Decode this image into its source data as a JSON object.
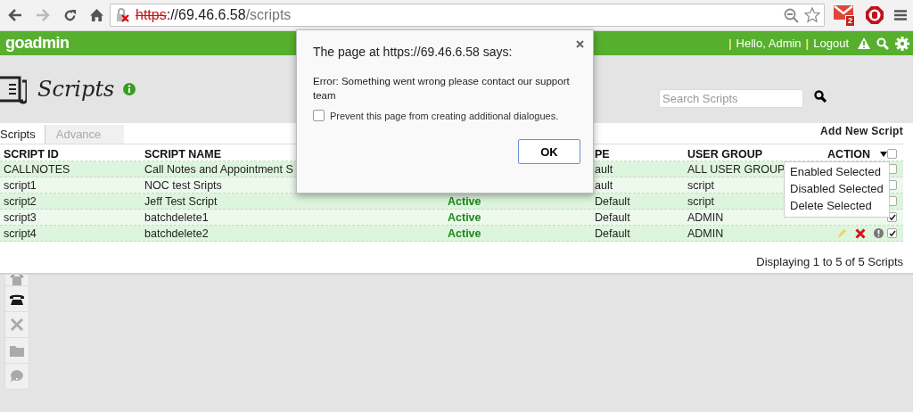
{
  "browser": {
    "url": {
      "secure": false,
      "scheme": "https",
      "rest": "://69.46.6.58",
      "path": "/scripts"
    },
    "mail_badge": "2"
  },
  "header": {
    "logo": {
      "go": "go",
      "admin": "admin"
    },
    "user_links": [
      {
        "kind": "separator",
        "text": "|"
      },
      {
        "kind": "text",
        "text": "Hello, Admin"
      },
      {
        "kind": "separator",
        "text": "|"
      },
      {
        "kind": "link",
        "text": "Logout"
      }
    ]
  },
  "page": {
    "title": "Scripts",
    "search": {
      "placeholder": "Search Scripts"
    }
  },
  "tabs": [
    {
      "label": "Scripts",
      "selected": true
    },
    {
      "label": "Advance",
      "selected": false
    }
  ],
  "add_button": "Add New Script",
  "table": {
    "columns": [
      "SCRIPT ID",
      "SCRIPT NAME",
      "",
      "PE",
      "USER GROUP",
      "ACTION"
    ],
    "header_checked": false,
    "rows": [
      {
        "id": "CALLNOTES",
        "name": "Call Notes and Appointment S",
        "type": "ault",
        "group": "ALL USER GROUP",
        "actions": false,
        "checked": false
      },
      {
        "id": "script1",
        "name": "NOC test Sripts",
        "type": "ault",
        "group": "script",
        "actions": false,
        "checked": false
      },
      {
        "id": "script2",
        "name": "Jeff Test Script",
        "status": "Active",
        "type": "Default",
        "group": "script",
        "actions": false,
        "checked": false
      },
      {
        "id": "script3",
        "name": "batchdelete1",
        "status": "Active",
        "type": "Default",
        "group": "ADMIN",
        "actions": false,
        "checked": true
      },
      {
        "id": "script4",
        "name": "batchdelete2",
        "status": "Active",
        "type": "Default",
        "group": "ADMIN",
        "actions": true,
        "checked": true
      }
    ]
  },
  "action_menu": [
    "Enabled Selected",
    "Disabled Selected",
    "Delete Selected"
  ],
  "footer": "Displaying 1 to 5 of 5 Scripts",
  "sidebar": {
    "items": [
      {
        "selected": false
      },
      {
        "selected": true
      },
      {
        "selected": false
      },
      {
        "selected": false
      },
      {
        "selected": false
      }
    ]
  },
  "dialog": {
    "title": "The page at https://69.46.6.58 says:",
    "message": "Error: Something went wrong please contact our support team",
    "checkbox": {
      "label": "Prevent this page from creating additional dialogues.",
      "checked": false
    },
    "button": "OK"
  }
}
